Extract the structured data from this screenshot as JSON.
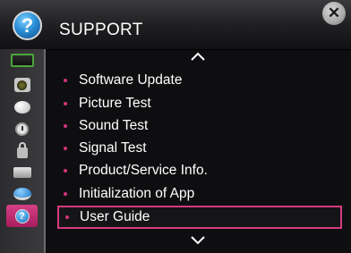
{
  "header": {
    "title": "SUPPORT",
    "help_icon": "help-icon",
    "close_icon": "close-icon",
    "help_glyph": "?",
    "close_glyph": "✕"
  },
  "sidebar": {
    "items": [
      {
        "icon": "monitor-icon"
      },
      {
        "icon": "speaker-icon"
      },
      {
        "icon": "satellite-dish-icon"
      },
      {
        "icon": "clock-icon"
      },
      {
        "icon": "lock-icon"
      },
      {
        "icon": "set-top-box-icon"
      },
      {
        "icon": "globe-icon"
      },
      {
        "icon": "help-icon",
        "selected": true,
        "glyph": "?"
      }
    ]
  },
  "menu": {
    "items": [
      {
        "label": "Software Update"
      },
      {
        "label": "Picture Test"
      },
      {
        "label": "Sound Test"
      },
      {
        "label": "Signal Test"
      },
      {
        "label": "Product/Service Info."
      },
      {
        "label": "Initialization of App"
      },
      {
        "label": "User Guide",
        "selected": true
      }
    ],
    "scroll_up_icon": "chevron-up-icon",
    "scroll_down_icon": "chevron-down-icon"
  },
  "colors": {
    "accent": "#d63b7e",
    "background": "#0e0e10",
    "text": "#ffffff"
  }
}
